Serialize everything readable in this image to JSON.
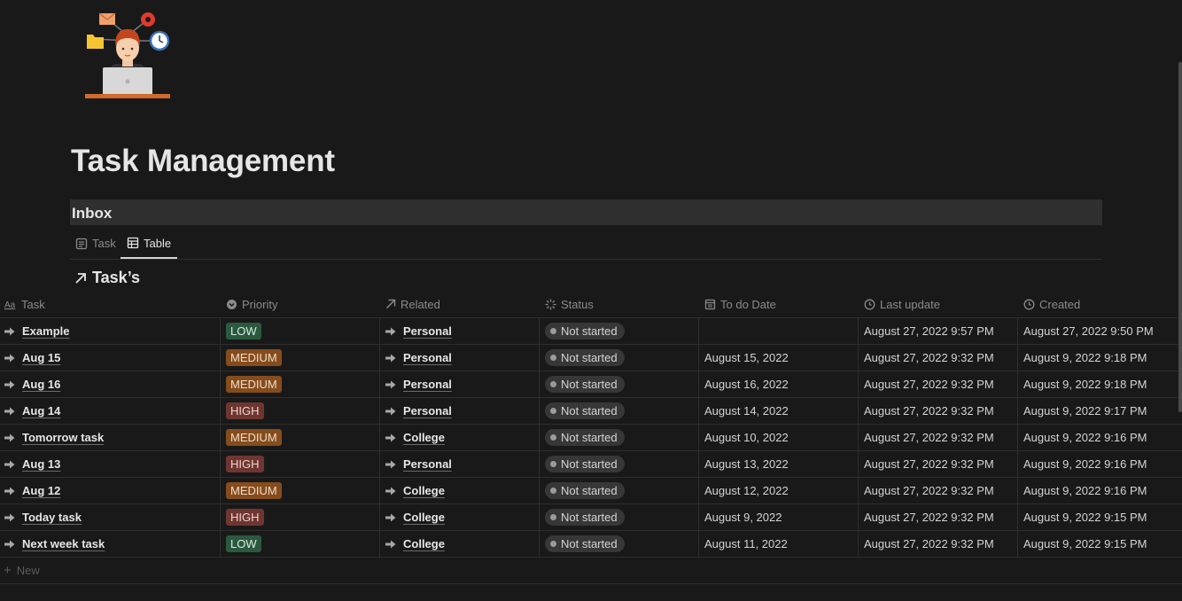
{
  "page": {
    "title": "Task Management"
  },
  "section": {
    "title": "Inbox"
  },
  "views": [
    {
      "label": "Task",
      "icon": "document-icon",
      "active": false
    },
    {
      "label": "Table",
      "icon": "table-icon",
      "active": true
    }
  ],
  "database": {
    "title": "Task’s",
    "icon": "arrow-up-right-icon"
  },
  "columns": [
    {
      "label": "Task",
      "icon": "text-aa-icon"
    },
    {
      "label": "Priority",
      "icon": "chevron-circle-icon"
    },
    {
      "label": "Related",
      "icon": "arrow-up-right-icon"
    },
    {
      "label": "Status",
      "icon": "status-spinner-icon"
    },
    {
      "label": "To do Date",
      "icon": "calendar-icon"
    },
    {
      "label": "Last update",
      "icon": "clock-icon"
    },
    {
      "label": "Created",
      "icon": "clock-icon"
    }
  ],
  "rows": [
    {
      "task": "Example",
      "priority": "LOW",
      "related": "Personal",
      "status": "Not started",
      "todo": "",
      "updated": "August 27, 2022 9:57 PM",
      "created": "August 27, 2022 9:50 PM"
    },
    {
      "task": "Aug 15",
      "priority": "MEDIUM",
      "related": "Personal",
      "status": "Not started",
      "todo": "August 15, 2022",
      "updated": "August 27, 2022 9:32 PM",
      "created": "August 9, 2022 9:18 PM"
    },
    {
      "task": "Aug 16",
      "priority": "MEDIUM",
      "related": "Personal",
      "status": "Not started",
      "todo": "August 16, 2022",
      "updated": "August 27, 2022 9:32 PM",
      "created": "August 9, 2022 9:18 PM"
    },
    {
      "task": "Aug 14",
      "priority": "HIGH",
      "related": "Personal",
      "status": "Not started",
      "todo": "August 14, 2022",
      "updated": "August 27, 2022 9:32 PM",
      "created": "August 9, 2022 9:17 PM"
    },
    {
      "task": "Tomorrow task",
      "priority": "MEDIUM",
      "related": "College",
      "status": "Not started",
      "todo": "August 10, 2022",
      "updated": "August 27, 2022 9:32 PM",
      "created": "August 9, 2022 9:16 PM"
    },
    {
      "task": "Aug 13",
      "priority": "HIGH",
      "related": "Personal",
      "status": "Not started",
      "todo": "August 13, 2022",
      "updated": "August 27, 2022 9:32 PM",
      "created": "August 9, 2022 9:16 PM"
    },
    {
      "task": "Aug 12",
      "priority": "MEDIUM",
      "related": "College",
      "status": "Not started",
      "todo": "August 12, 2022",
      "updated": "August 27, 2022 9:32 PM",
      "created": "August 9, 2022 9:16 PM"
    },
    {
      "task": "Today task",
      "priority": "HIGH",
      "related": "College",
      "status": "Not started",
      "todo": "August 9, 2022",
      "updated": "August 27, 2022 9:32 PM",
      "created": "August 9, 2022 9:15 PM"
    },
    {
      "task": "Next week task",
      "priority": "LOW",
      "related": "College",
      "status": "Not started",
      "todo": "August 11, 2022",
      "updated": "August 27, 2022 9:32 PM",
      "created": "August 9, 2022 9:15 PM"
    }
  ],
  "new_row_label": "New",
  "colors": {
    "background": "#191919",
    "low": "#2b593f",
    "medium": "#854c1d",
    "high": "#6e3630",
    "status_pill": "#373737"
  }
}
